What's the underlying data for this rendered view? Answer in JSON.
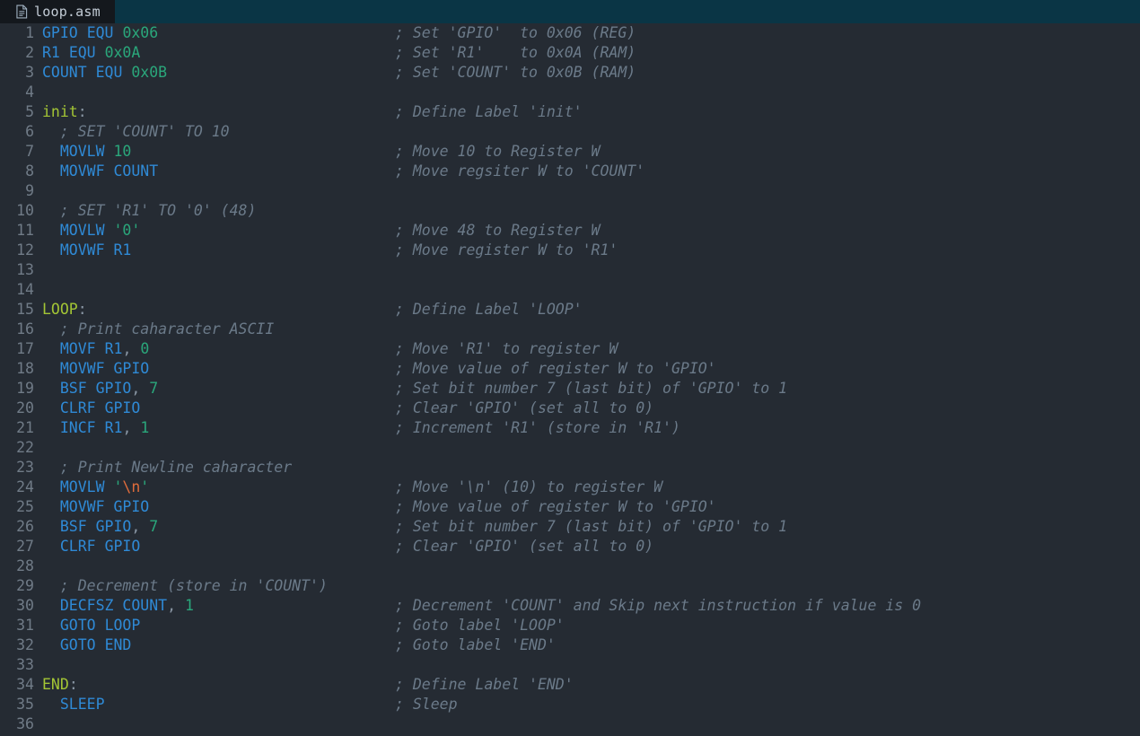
{
  "tab": {
    "filename": "loop.asm",
    "icon": "file-document-icon"
  },
  "theme": {
    "background": "#252b33",
    "tab_active_bg": "#14181d",
    "tab_bar_bg": "#0a3545",
    "gutter_fg": "#707b87",
    "identifier": "#2f8ad6",
    "number": "#2aa77b",
    "string": "#2aa77b",
    "escape": "#e06c3b",
    "label": "#a3c535",
    "comment": "#6b7a89",
    "punctuation": "#8a97a5"
  },
  "editor": {
    "language": "pic-assembly",
    "first_line": 1,
    "last_line": 36,
    "lines": [
      {
        "n": "1",
        "tokens": [
          {
            "t": "id",
            "v": "GPIO"
          },
          {
            "t": "sp",
            "v": " "
          },
          {
            "t": "kw",
            "v": "EQU"
          },
          {
            "t": "sp",
            "v": " "
          },
          {
            "t": "num",
            "v": "0x06"
          }
        ],
        "comment": "; Set 'GPIO'  to 0x06 (REG)"
      },
      {
        "n": "2",
        "tokens": [
          {
            "t": "id",
            "v": "R1"
          },
          {
            "t": "sp",
            "v": " "
          },
          {
            "t": "kw",
            "v": "EQU"
          },
          {
            "t": "sp",
            "v": " "
          },
          {
            "t": "num",
            "v": "0x0A"
          }
        ],
        "comment": "; Set 'R1'    to 0x0A (RAM)"
      },
      {
        "n": "3",
        "tokens": [
          {
            "t": "id",
            "v": "COUNT"
          },
          {
            "t": "sp",
            "v": " "
          },
          {
            "t": "kw",
            "v": "EQU"
          },
          {
            "t": "sp",
            "v": " "
          },
          {
            "t": "num",
            "v": "0x0B"
          }
        ],
        "comment": "; Set 'COUNT' to 0x0B (RAM)"
      },
      {
        "n": "4",
        "tokens": [],
        "comment": ""
      },
      {
        "n": "5",
        "tokens": [
          {
            "t": "label",
            "v": "init"
          },
          {
            "t": "punc",
            "v": ":"
          }
        ],
        "comment": "; Define Label 'init'"
      },
      {
        "n": "6",
        "tokens": [],
        "comment": "",
        "inline_comment": "  ; SET 'COUNT' TO 10"
      },
      {
        "n": "7",
        "tokens": [
          {
            "t": "sp",
            "v": "  "
          },
          {
            "t": "kw",
            "v": "MOVLW"
          },
          {
            "t": "sp",
            "v": " "
          },
          {
            "t": "num",
            "v": "10"
          }
        ],
        "comment": "; Move 10 to Register W"
      },
      {
        "n": "8",
        "tokens": [
          {
            "t": "sp",
            "v": "  "
          },
          {
            "t": "kw",
            "v": "MOVWF"
          },
          {
            "t": "sp",
            "v": " "
          },
          {
            "t": "id",
            "v": "COUNT"
          }
        ],
        "comment": "; Move regsiter W to 'COUNT'"
      },
      {
        "n": "9",
        "tokens": [],
        "comment": ""
      },
      {
        "n": "10",
        "tokens": [],
        "comment": "",
        "inline_comment": "  ; SET 'R1' TO '0' (48)"
      },
      {
        "n": "11",
        "tokens": [
          {
            "t": "sp",
            "v": "  "
          },
          {
            "t": "kw",
            "v": "MOVLW"
          },
          {
            "t": "sp",
            "v": " "
          },
          {
            "t": "str",
            "v": "'0'"
          }
        ],
        "comment": "; Move 48 to Register W"
      },
      {
        "n": "12",
        "tokens": [
          {
            "t": "sp",
            "v": "  "
          },
          {
            "t": "kw",
            "v": "MOVWF"
          },
          {
            "t": "sp",
            "v": " "
          },
          {
            "t": "id",
            "v": "R1"
          }
        ],
        "comment": "; Move register W to 'R1'"
      },
      {
        "n": "13",
        "tokens": [],
        "comment": ""
      },
      {
        "n": "14",
        "tokens": [],
        "comment": ""
      },
      {
        "n": "15",
        "tokens": [
          {
            "t": "label",
            "v": "LOOP"
          },
          {
            "t": "punc",
            "v": ":"
          }
        ],
        "comment": "; Define Label 'LOOP'"
      },
      {
        "n": "16",
        "tokens": [],
        "comment": "",
        "inline_comment": "  ; Print caharacter ASCII"
      },
      {
        "n": "17",
        "tokens": [
          {
            "t": "sp",
            "v": "  "
          },
          {
            "t": "kw",
            "v": "MOVF"
          },
          {
            "t": "sp",
            "v": " "
          },
          {
            "t": "id",
            "v": "R1"
          },
          {
            "t": "punc",
            "v": ","
          },
          {
            "t": "sp",
            "v": " "
          },
          {
            "t": "num",
            "v": "0"
          }
        ],
        "comment": "; Move 'R1' to register W"
      },
      {
        "n": "18",
        "tokens": [
          {
            "t": "sp",
            "v": "  "
          },
          {
            "t": "kw",
            "v": "MOVWF"
          },
          {
            "t": "sp",
            "v": " "
          },
          {
            "t": "id",
            "v": "GPIO"
          }
        ],
        "comment": "; Move value of register W to 'GPIO'"
      },
      {
        "n": "19",
        "tokens": [
          {
            "t": "sp",
            "v": "  "
          },
          {
            "t": "kw",
            "v": "BSF"
          },
          {
            "t": "sp",
            "v": " "
          },
          {
            "t": "id",
            "v": "GPIO"
          },
          {
            "t": "punc",
            "v": ","
          },
          {
            "t": "sp",
            "v": " "
          },
          {
            "t": "num",
            "v": "7"
          }
        ],
        "comment": "; Set bit number 7 (last bit) of 'GPIO' to 1"
      },
      {
        "n": "20",
        "tokens": [
          {
            "t": "sp",
            "v": "  "
          },
          {
            "t": "kw",
            "v": "CLRF"
          },
          {
            "t": "sp",
            "v": " "
          },
          {
            "t": "id",
            "v": "GPIO"
          }
        ],
        "comment": "; Clear 'GPIO' (set all to 0)"
      },
      {
        "n": "21",
        "tokens": [
          {
            "t": "sp",
            "v": "  "
          },
          {
            "t": "kw",
            "v": "INCF"
          },
          {
            "t": "sp",
            "v": " "
          },
          {
            "t": "id",
            "v": "R1"
          },
          {
            "t": "punc",
            "v": ","
          },
          {
            "t": "sp",
            "v": " "
          },
          {
            "t": "num",
            "v": "1"
          }
        ],
        "comment": "; Increment 'R1' (store in 'R1')"
      },
      {
        "n": "22",
        "tokens": [],
        "comment": ""
      },
      {
        "n": "23",
        "tokens": [],
        "comment": "",
        "inline_comment": "  ; Print Newline caharacter"
      },
      {
        "n": "24",
        "tokens": [
          {
            "t": "sp",
            "v": "  "
          },
          {
            "t": "kw",
            "v": "MOVLW"
          },
          {
            "t": "sp",
            "v": " "
          },
          {
            "t": "str",
            "v": "'"
          },
          {
            "t": "esc",
            "v": "\\n"
          },
          {
            "t": "str",
            "v": "'"
          }
        ],
        "comment": "; Move '\\n' (10) to register W"
      },
      {
        "n": "25",
        "tokens": [
          {
            "t": "sp",
            "v": "  "
          },
          {
            "t": "kw",
            "v": "MOVWF"
          },
          {
            "t": "sp",
            "v": " "
          },
          {
            "t": "id",
            "v": "GPIO"
          }
        ],
        "comment": "; Move value of register W to 'GPIO'"
      },
      {
        "n": "26",
        "tokens": [
          {
            "t": "sp",
            "v": "  "
          },
          {
            "t": "kw",
            "v": "BSF"
          },
          {
            "t": "sp",
            "v": " "
          },
          {
            "t": "id",
            "v": "GPIO"
          },
          {
            "t": "punc",
            "v": ","
          },
          {
            "t": "sp",
            "v": " "
          },
          {
            "t": "num",
            "v": "7"
          }
        ],
        "comment": "; Set bit number 7 (last bit) of 'GPIO' to 1"
      },
      {
        "n": "27",
        "tokens": [
          {
            "t": "sp",
            "v": "  "
          },
          {
            "t": "kw",
            "v": "CLRF"
          },
          {
            "t": "sp",
            "v": " "
          },
          {
            "t": "id",
            "v": "GPIO"
          }
        ],
        "comment": "; Clear 'GPIO' (set all to 0)"
      },
      {
        "n": "28",
        "tokens": [],
        "comment": ""
      },
      {
        "n": "29",
        "tokens": [],
        "comment": "",
        "inline_comment": "  ; Decrement (store in 'COUNT')"
      },
      {
        "n": "30",
        "tokens": [
          {
            "t": "sp",
            "v": "  "
          },
          {
            "t": "kw",
            "v": "DECFSZ"
          },
          {
            "t": "sp",
            "v": " "
          },
          {
            "t": "id",
            "v": "COUNT"
          },
          {
            "t": "punc",
            "v": ","
          },
          {
            "t": "sp",
            "v": " "
          },
          {
            "t": "num",
            "v": "1"
          }
        ],
        "comment": "; Decrement 'COUNT' and Skip next instruction if value is 0"
      },
      {
        "n": "31",
        "tokens": [
          {
            "t": "sp",
            "v": "  "
          },
          {
            "t": "kw",
            "v": "GOTO"
          },
          {
            "t": "sp",
            "v": " "
          },
          {
            "t": "id",
            "v": "LOOP"
          }
        ],
        "comment": "; Goto label 'LOOP'"
      },
      {
        "n": "32",
        "tokens": [
          {
            "t": "sp",
            "v": "  "
          },
          {
            "t": "kw",
            "v": "GOTO"
          },
          {
            "t": "sp",
            "v": " "
          },
          {
            "t": "id",
            "v": "END"
          }
        ],
        "comment": "; Goto label 'END'"
      },
      {
        "n": "33",
        "tokens": [],
        "comment": ""
      },
      {
        "n": "34",
        "tokens": [
          {
            "t": "label",
            "v": "END"
          },
          {
            "t": "punc",
            "v": ":"
          }
        ],
        "comment": "; Define Label 'END'"
      },
      {
        "n": "35",
        "tokens": [
          {
            "t": "sp",
            "v": "  "
          },
          {
            "t": "kw",
            "v": "SLEEP"
          }
        ],
        "comment": "; Sleep"
      },
      {
        "n": "36",
        "tokens": [],
        "comment": ""
      }
    ]
  }
}
